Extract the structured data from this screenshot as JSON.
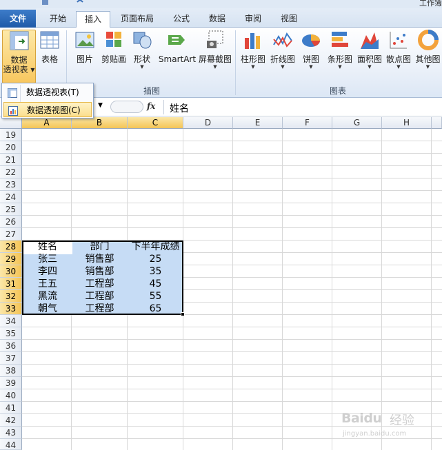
{
  "window": {
    "title": "工作簿"
  },
  "tabs": [
    {
      "label": "文件"
    },
    {
      "label": "开始"
    },
    {
      "label": "插入"
    },
    {
      "label": "页面布局"
    },
    {
      "label": "公式"
    },
    {
      "label": "数据"
    },
    {
      "label": "审阅"
    },
    {
      "label": "视图"
    }
  ],
  "ribbon": {
    "pivot": {
      "label1": "数据",
      "label2": "透视表"
    },
    "table": {
      "label": "表格"
    },
    "picture": {
      "label": "图片"
    },
    "clipart": {
      "label": "剪贴画"
    },
    "shapes": {
      "label": "形状"
    },
    "smartart": {
      "label": "SmartArt"
    },
    "screenshot": {
      "label": "屏幕截图"
    },
    "column": {
      "label": "柱形图"
    },
    "line": {
      "label": "折线图"
    },
    "pie": {
      "label": "饼图"
    },
    "bar": {
      "label": "条形图"
    },
    "area": {
      "label": "面积图"
    },
    "scatter": {
      "label": "散点图"
    },
    "other": {
      "label": "其他图"
    },
    "groups": {
      "illustrations": "插图",
      "charts": "图表"
    }
  },
  "menu": {
    "items": [
      {
        "label": "数据透视表(T)"
      },
      {
        "label": "数据透视图(C)"
      }
    ]
  },
  "formula_bar": {
    "fx": "fx",
    "value": "姓名"
  },
  "columns": [
    "A",
    "B",
    "C",
    "D",
    "E",
    "F",
    "G",
    "H"
  ],
  "rows": [
    "19",
    "20",
    "21",
    "22",
    "23",
    "24",
    "25",
    "26",
    "27",
    "28",
    "29",
    "30",
    "31",
    "32",
    "33",
    "34",
    "35",
    "36",
    "37",
    "38",
    "39",
    "40",
    "41",
    "42",
    "43",
    "44"
  ],
  "table": {
    "headers": [
      "姓名",
      "部门",
      "下半年成绩"
    ],
    "rows": [
      [
        "张三",
        "销售部",
        "25"
      ],
      [
        "李四",
        "销售部",
        "35"
      ],
      [
        "王五",
        "工程部",
        "45"
      ],
      [
        "黑流",
        "工程部",
        "55"
      ],
      [
        "朝气",
        "工程部",
        "65"
      ]
    ]
  },
  "watermark": {
    "brand": "Baidu",
    "cn": "经验",
    "url": "jingyan.baidu.com"
  },
  "colors": {
    "accent": "#1f5aa8",
    "selection": "#c6dcf5",
    "highlight": "#f4c456"
  }
}
